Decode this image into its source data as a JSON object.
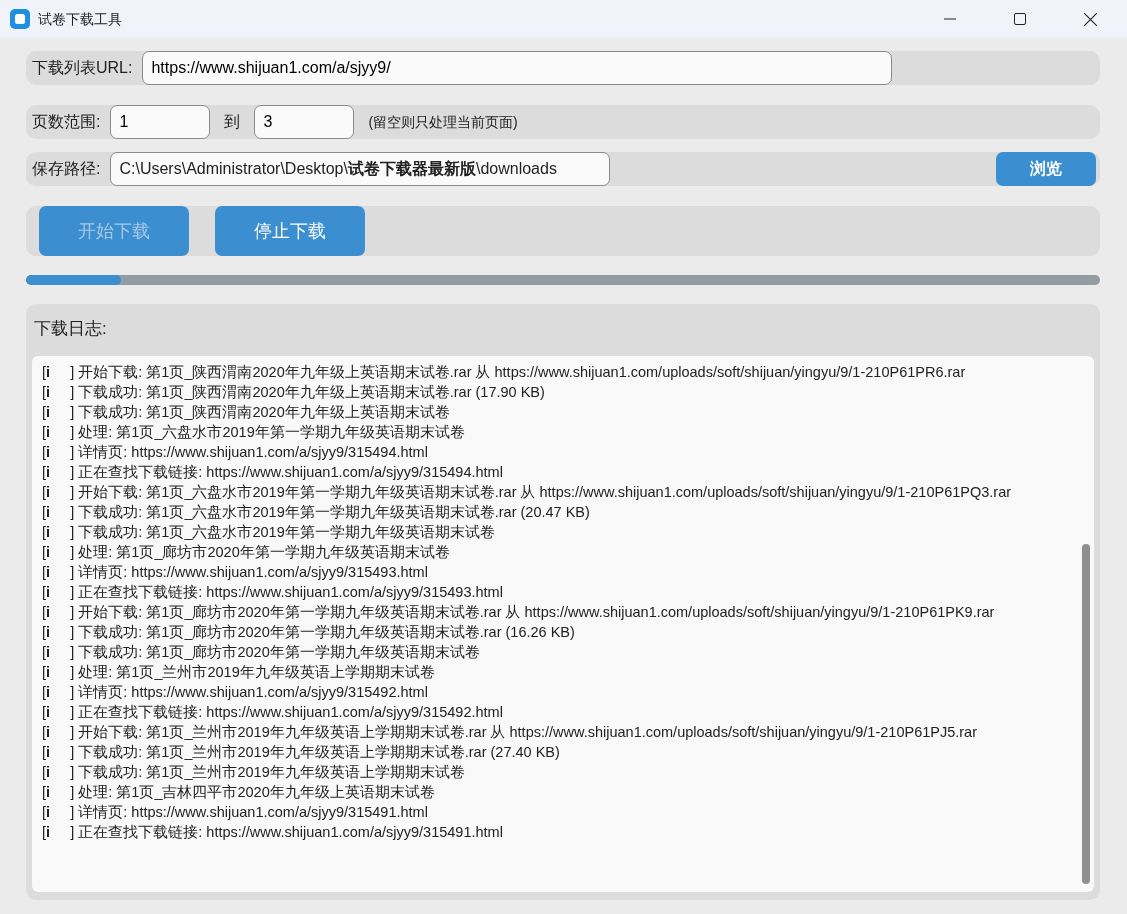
{
  "window": {
    "title": "试卷下载工具"
  },
  "url_row": {
    "label": "下载列表URL:",
    "value": "https://www.shijuan1.com/a/sjyy9/"
  },
  "page_row": {
    "label": "页数范围:",
    "from": "1",
    "separator": "到",
    "to": "3",
    "hint": "(留空则只处理当前页面)"
  },
  "path_row": {
    "label": "保存路径:",
    "value": "C:\\Users\\Administrator\\Desktop\\**试卷下载器最新版**\\downloads",
    "browse": "浏览"
  },
  "buttons": [
    {
      "label": "开始下载",
      "disabled": true
    },
    {
      "label": "停止下载",
      "disabled": false
    }
  ],
  "progress": {
    "level": 0.088
  },
  "log": {
    "title": "下载日志:",
    "lines": [
      "[**i**     ] 开始下载: 第1页_陕西渭南2020年九年级上英语期末试卷.rar 从 https://www.shijuan1.com/uploads/soft/shijuan/yingyu/9/1-210P61PR6.rar",
      "[**i**     ] 下载成功: 第1页_陕西渭南2020年九年级上英语期末试卷.rar (17.90 KB)",
      "[**i**     ] 下载成功: 第1页_陕西渭南2020年九年级上英语期末试卷",
      "[**i**     ] 处理: 第1页_六盘水市2019年第一学期九年级英语期末试卷",
      "[**i**     ] 详情页: https://www.shijuan1.com/a/sjyy9/315494.html",
      "[**i**     ] 正在查找下载链接: https://www.shijuan1.com/a/sjyy9/315494.html",
      "[**i**     ] 开始下载: 第1页_六盘水市2019年第一学期九年级英语期末试卷.rar 从 https://www.shijuan1.com/uploads/soft/shijuan/yingyu/9/1-210P61PQ3.rar",
      "[**i**     ] 下载成功: 第1页_六盘水市2019年第一学期九年级英语期末试卷.rar (20.47 KB)",
      "[**i**     ] 下载成功: 第1页_六盘水市2019年第一学期九年级英语期末试卷",
      "[**i**     ] 处理: 第1页_廊坊市2020年第一学期九年级英语期末试卷",
      "[**i**     ] 详情页: https://www.shijuan1.com/a/sjyy9/315493.html",
      "[**i**     ] 正在查找下载链接: https://www.shijuan1.com/a/sjyy9/315493.html",
      "[**i**     ] 开始下载: 第1页_廊坊市2020年第一学期九年级英语期末试卷.rar 从 https://www.shijuan1.com/uploads/soft/shijuan/yingyu/9/1-210P61PK9.rar",
      "[**i**     ] 下载成功: 第1页_廊坊市2020年第一学期九年级英语期末试卷.rar (16.26 KB)",
      "[**i**     ] 下载成功: 第1页_廊坊市2020年第一学期九年级英语期末试卷",
      "[**i**     ] 处理: 第1页_兰州市2019年九年级英语上学期期末试卷",
      "[**i**     ] 详情页: https://www.shijuan1.com/a/sjyy9/315492.html",
      "[**i**     ] 正在查找下载链接: https://www.shijuan1.com/a/sjyy9/315492.html",
      "[**i**     ] 开始下载: 第1页_兰州市2019年九年级英语上学期期末试卷.rar 从 https://www.shijuan1.com/uploads/soft/shijuan/yingyu/9/1-210P61PJ5.rar",
      "[**i**     ] 下载成功: 第1页_兰州市2019年九年级英语上学期期末试卷.rar (27.40 KB)",
      "[**i**     ] 下载成功: 第1页_兰州市2019年九年级英语上学期期末试卷",
      "[**i**     ] 处理: 第1页_吉林四平市2020年九年级上英语期末试卷",
      "[**i**     ] 详情页: https://www.shijuan1.com/a/sjyy9/315491.html",
      "[**i**     ] 正在查找下载链接: https://www.shijuan1.com/a/sjyy9/315491.html"
    ]
  }
}
